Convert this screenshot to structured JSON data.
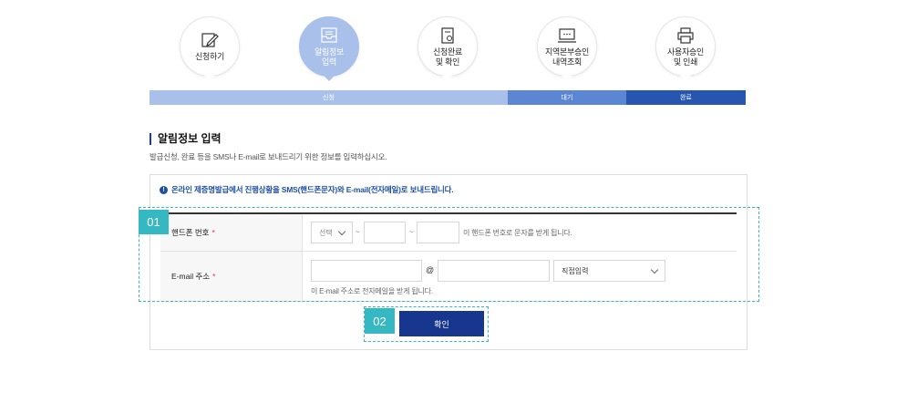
{
  "steps": [
    {
      "label": "신청하기",
      "icon": "pencil-document-icon",
      "active": false
    },
    {
      "label": "알림정보\n입력",
      "icon": "inbox-icon",
      "active": true
    },
    {
      "label": "신청완료\n및 확인",
      "icon": "document-check-icon",
      "active": false
    },
    {
      "label": "지역본부승인\n내역조회",
      "icon": "monitor-icon",
      "active": false
    },
    {
      "label": "사용자승인\n및 인쇄",
      "icon": "printer-icon",
      "active": false
    }
  ],
  "progress": {
    "applied": "신청",
    "waiting": "대기",
    "done": "완료"
  },
  "section": {
    "title": "알림정보 입력",
    "description": "발급신청, 완료 등을 SMS나 E-mail로 보내드리기 위한 정보를 입력하십시오."
  },
  "notice": "온라인 제증명발급에서 진행상황을 SMS(핸드폰문자)와 E-mail(전자메일)로 보내드립니다.",
  "form": {
    "phone": {
      "label": "핸드폰 번호",
      "required_mark": "*",
      "prefix_select": "선택",
      "dash": "~",
      "hint": "이 핸드폰 번호로 문자를 받게 됩니다."
    },
    "email": {
      "label": "E-mail 주소",
      "required_mark": "*",
      "at": "@",
      "domain_select": "직접입력",
      "hint": "이 E-mail 주소로 전자메일을 받게 됩니다."
    }
  },
  "badges": {
    "one": "01",
    "two": "02"
  },
  "confirm_label": "확인",
  "colors": {
    "accent": "#17378f",
    "highlight": "#36b8c2",
    "active_step": "#a9c0ea"
  }
}
